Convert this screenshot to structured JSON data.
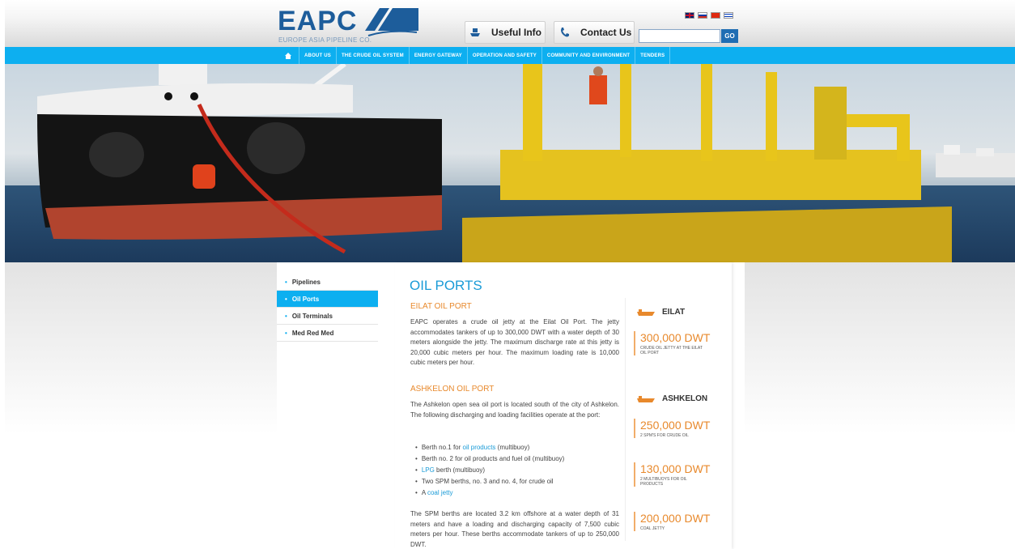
{
  "header": {
    "logo_text": "EAPC",
    "logo_sub": "EUROPE ASIA PIPELINE CO.",
    "useful_info": "Useful Info",
    "contact_us": "Contact Us",
    "search_button": "GO",
    "search_value": ""
  },
  "nav": {
    "items": [
      "ABOUT US",
      "THE CRUDE OIL SYSTEM",
      "ENERGY GATEWAY",
      "OPERATION AND SAFETY",
      "COMMUNITY AND ENVIRONMENT",
      "TENDERS"
    ]
  },
  "sidebar": {
    "items": [
      "Pipelines",
      "Oil Ports",
      "Oil Terminals",
      "Med Red Med"
    ],
    "active": "Oil Ports"
  },
  "main": {
    "title": "OIL PORTS",
    "eilat": {
      "heading": "EILAT OIL PORT",
      "body": "EAPC operates a crude oil jetty at the Eilat Oil Port. The jetty accommodates tankers of up to 300,000 DWT with a water depth of 30 meters alongside the jetty. The maximum discharge rate at this jetty is 20,000 cubic meters per hour. The maximum loading rate is 10,000 cubic meters per hour."
    },
    "ashkelon": {
      "heading": "ASHKELON OIL PORT",
      "body": "The Ashkelon open sea oil port is located south of the city of Ashkelon. The following discharging and loading facilities operate at the port:",
      "bullets": {
        "b1_pre": "Berth no.1 for ",
        "b1_link": "oil products",
        "b1_post": " (multibuoy)",
        "b2": "Berth no. 2 for oil products and fuel oil (multibuoy)",
        "b3_link": "LPG",
        "b3_post": " berth (multibuoy)",
        "b4": "Two SPM berths, no. 3 and no. 4, for crude oil",
        "b5_pre": "A ",
        "b5_link": "coal jetty"
      },
      "footer": "The SPM berths are located 3.2 km offshore at a water depth of 31 meters and have a loading and discharging capacity of 7,500 cubic meters per hour. These berths accommodate tankers of up to 250,000 DWT."
    }
  },
  "stats": {
    "eilat_label": "EILAT",
    "eilat_value": "300,000 DWT",
    "eilat_caption": "CRUDE OIL JETTY AT THE EILAT OIL PORT",
    "ashkelon_label": "ASHKELON",
    "s1_value": "250,000 DWT",
    "s1_caption": "2 SPM'S FOR CRUDE OIL",
    "s2_value": "130,000 DWT",
    "s2_caption": "2 MULTIBUOYS FOR OIL PRODUCTS",
    "s3_value": "200,000 DWT",
    "s3_caption": "COAL JETTY"
  },
  "colors": {
    "nav": "#0daff0",
    "accent_orange": "#e8892c",
    "title_blue": "#1a9bd7",
    "logo_blue": "#1d5d9b"
  }
}
